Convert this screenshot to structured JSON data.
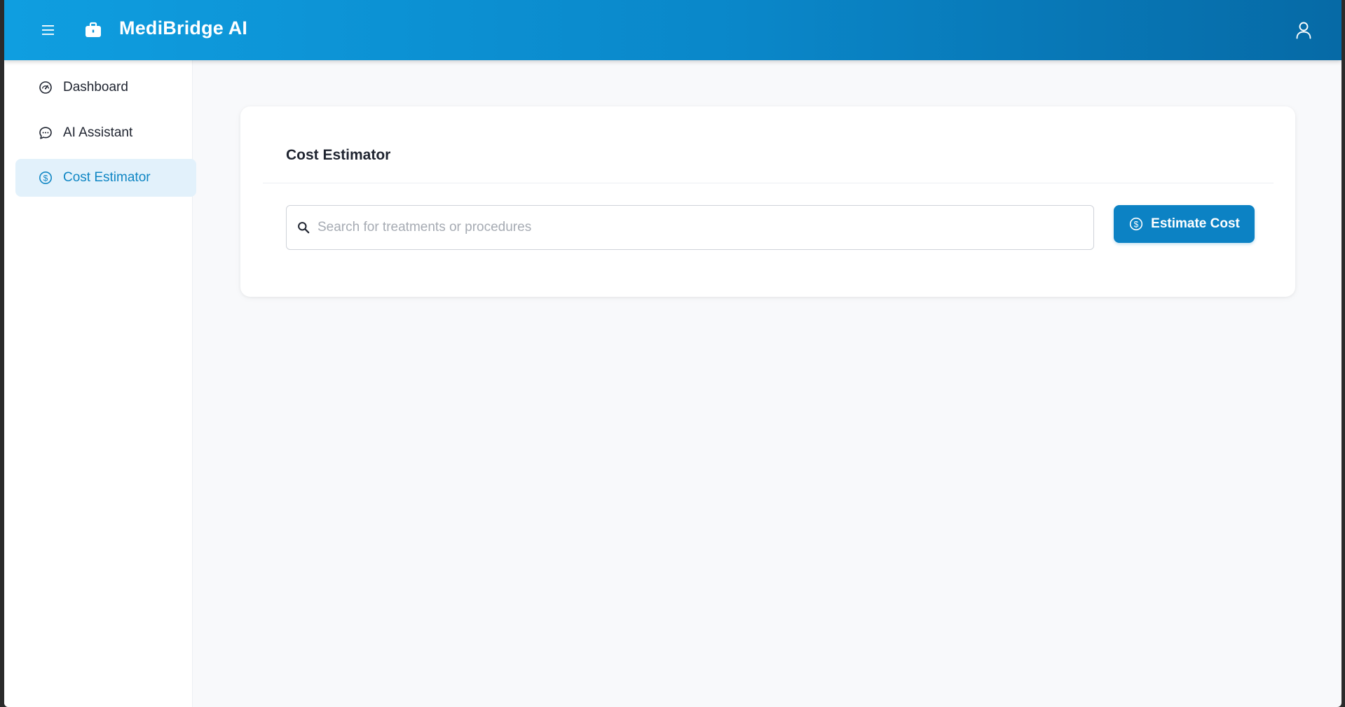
{
  "app": {
    "title": "MediBridge AI",
    "accent_color": "#0c82c4",
    "header_gradient": [
      "#0f9ee0",
      "#066aa6"
    ]
  },
  "header": {
    "menu_icon": "hamburger-menu-icon",
    "brand_icon": "medical-kit-icon",
    "user_icon": "user-profile-icon"
  },
  "sidebar": {
    "items": [
      {
        "label": "Dashboard",
        "icon": "gauge-icon",
        "active": false
      },
      {
        "label": "AI Assistant",
        "icon": "chat-bubble-icon",
        "active": false
      },
      {
        "label": "Cost Estimator",
        "icon": "dollar-circle-icon",
        "active": true
      }
    ]
  },
  "main": {
    "card": {
      "title": "Cost Estimator",
      "search": {
        "placeholder": "Search for treatments or procedures",
        "value": "",
        "icon": "search-icon"
      },
      "button": {
        "label": "Estimate Cost",
        "icon": "dollar-circle-icon"
      }
    }
  }
}
